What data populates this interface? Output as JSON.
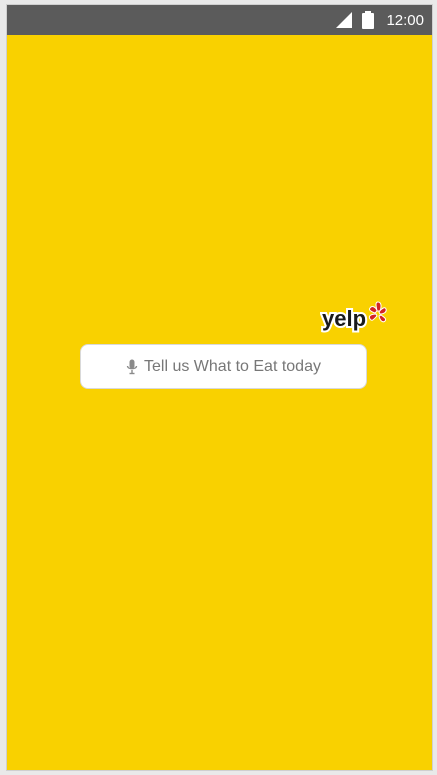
{
  "status_bar": {
    "time": "12:00",
    "icons": [
      "signal-icon",
      "battery-icon"
    ]
  },
  "logo": {
    "text": "yelp",
    "name": "yelp-logo"
  },
  "search": {
    "placeholder": "Tell us What to Eat today",
    "icon": "microphone-icon"
  },
  "colors": {
    "background": "#f9d100",
    "status_bar": "#5b5b5b",
    "logo_red": "#d32323",
    "input_text": "#777777"
  }
}
